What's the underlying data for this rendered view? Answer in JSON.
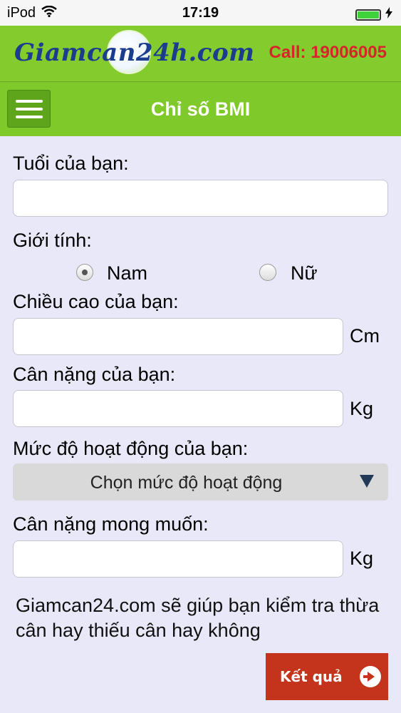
{
  "status_bar": {
    "carrier": "iPod",
    "time": "17:19"
  },
  "header": {
    "logo_text": "Giamcan24h.com",
    "call_text": "Call: 19006005",
    "page_title": "Chỉ số BMI"
  },
  "form": {
    "age_label": "Tuổi của bạn:",
    "age_value": "",
    "gender_label": "Giới tính:",
    "gender_options": [
      {
        "label": "Nam",
        "checked": true
      },
      {
        "label": "Nữ",
        "checked": false
      }
    ],
    "height_label": "Chiều cao của bạn:",
    "height_value": "",
    "height_unit": "Cm",
    "weight_label": "Cân nặng của bạn:",
    "weight_value": "",
    "weight_unit": "Kg",
    "activity_label": "Mức độ hoạt động của bạn:",
    "activity_selected": "Chọn mức độ hoạt động",
    "target_weight_label": "Cân nặng mong muốn:",
    "target_weight_value": "",
    "target_weight_unit": "Kg",
    "note": "Giamcan24.com sẽ giúp bạn kiểm tra thừa cân hay thiếu cân hay không",
    "submit_label": "Kết quả"
  },
  "icons": {
    "wifi": "wifi-icon",
    "battery": "battery-icon",
    "charging": "charging-icon",
    "menu": "hamburger-menu-icon",
    "dropdown": "dropdown-arrow-icon",
    "submit": "arrow-circle-right-icon"
  },
  "colors": {
    "header_green": "#80c92b",
    "call_red": "#d6262a",
    "button_red": "#c4331b",
    "background": "#e9e8f8"
  }
}
